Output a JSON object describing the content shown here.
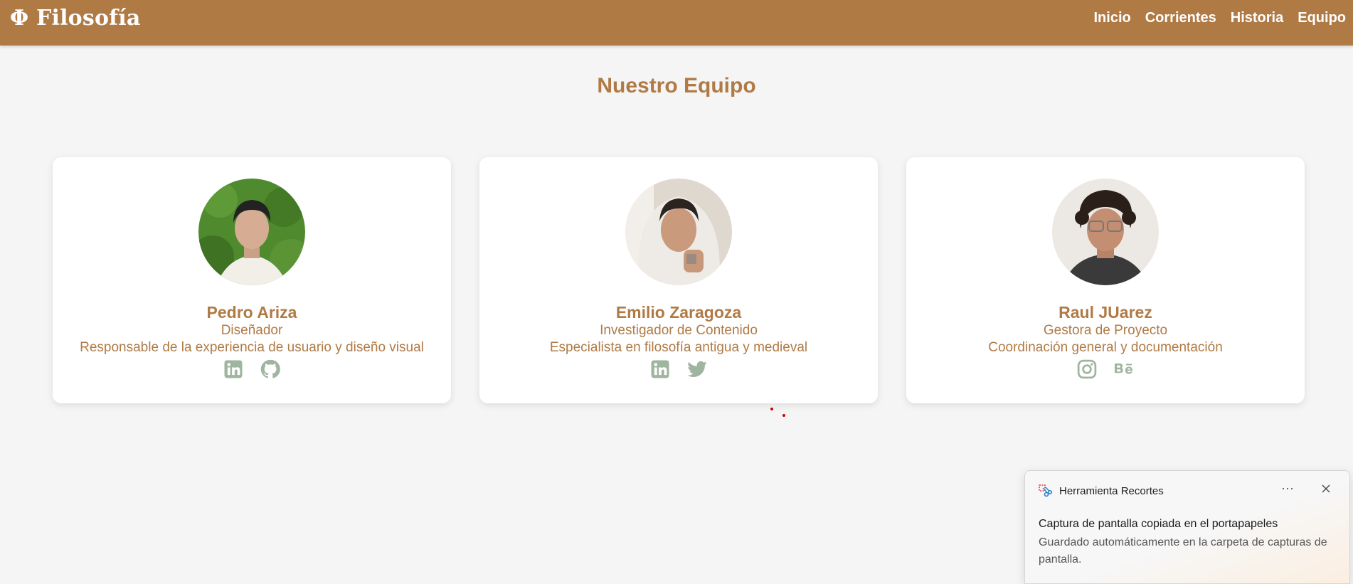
{
  "navbar": {
    "brand": "Φ Filosofía",
    "links": [
      "Inicio",
      "Corrientes",
      "Historia",
      "Equipo"
    ]
  },
  "section": {
    "title": "Nuestro Equipo"
  },
  "team": [
    {
      "name": "Pedro Ariza",
      "role": "Diseñador",
      "description": "Responsable de la experiencia de usuario y diseño visual",
      "socials": [
        "linkedin-icon",
        "github-icon"
      ]
    },
    {
      "name": "Emilio Zaragoza",
      "role": "Investigador de Contenido",
      "description": "Especialista en filosofía antigua y medieval",
      "socials": [
        "linkedin-icon",
        "twitter-icon"
      ]
    },
    {
      "name": "Raul JUarez",
      "role": "Gestora de Proyecto",
      "description": "Coordinación general y documentación",
      "socials": [
        "instagram-icon",
        "behance-icon"
      ]
    }
  ],
  "toast": {
    "app_name": "Herramienta Recortes",
    "more": "···",
    "title": "Captura de pantalla copiada en el portapapeles",
    "body": "Guardado automáticamente en la carpeta de capturas de pantalla."
  },
  "colors": {
    "navbar": "#b07a45",
    "accent": "#b07a45",
    "social_icon": "#9fb59f",
    "background": "#f5f5f5"
  }
}
